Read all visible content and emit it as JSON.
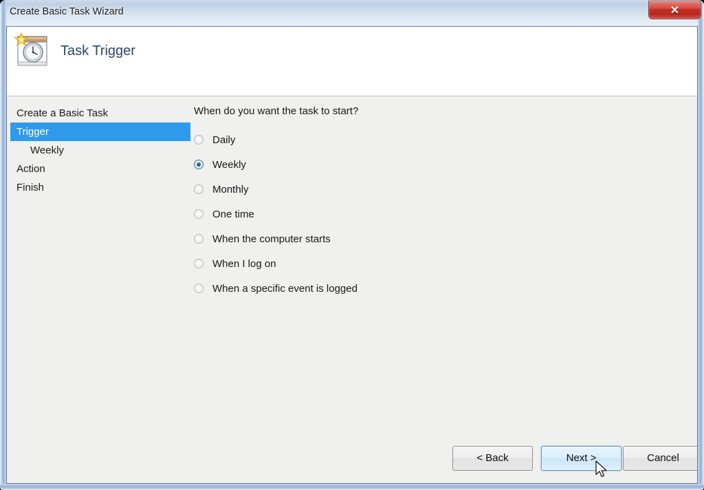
{
  "window": {
    "title": "Create Basic Task Wizard",
    "close_glyph": "✕",
    "accent_blue": "#2f9ae9",
    "frame_blue": "#93b3d8"
  },
  "header": {
    "page_title": "Task Trigger",
    "icon_name": "task-scheduler-clock-icon"
  },
  "sidebar": {
    "items": [
      {
        "label": "Create a Basic Task",
        "selected": false,
        "sub": false
      },
      {
        "label": "Trigger",
        "selected": true,
        "sub": false
      },
      {
        "label": "Weekly",
        "selected": false,
        "sub": true
      },
      {
        "label": "Action",
        "selected": false,
        "sub": false
      },
      {
        "label": "Finish",
        "selected": false,
        "sub": false
      }
    ]
  },
  "main": {
    "question": "When do you want the task to start?",
    "options": [
      {
        "label": "Daily",
        "checked": false
      },
      {
        "label": "Weekly",
        "checked": true
      },
      {
        "label": "Monthly",
        "checked": false
      },
      {
        "label": "One time",
        "checked": false
      },
      {
        "label": "When the computer starts",
        "checked": false
      },
      {
        "label": "When I log on",
        "checked": false
      },
      {
        "label": "When a specific event is logged",
        "checked": false
      }
    ]
  },
  "footer": {
    "back_label": "< Back",
    "next_label": "Next >",
    "cancel_label": "Cancel"
  }
}
